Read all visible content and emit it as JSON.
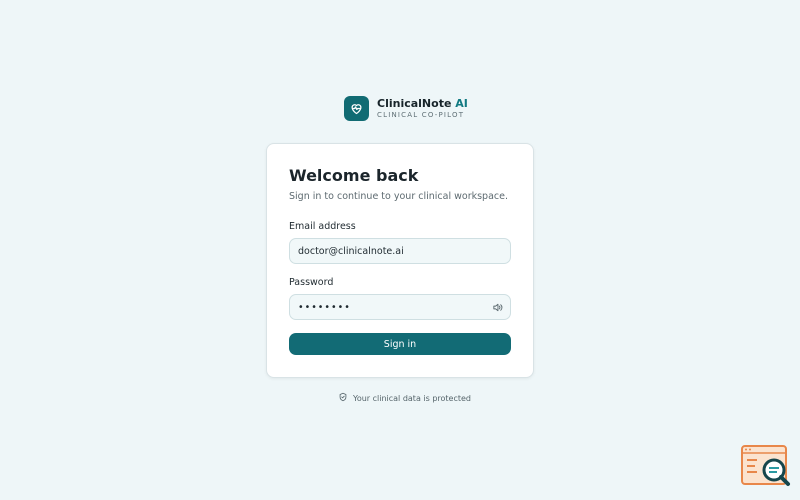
{
  "brand": {
    "name_main": "ClinicalNote",
    "name_accent": " AI",
    "tagline": "CLINICAL CO-PILOT",
    "logo_icon": "heart-pulse-icon"
  },
  "card": {
    "title": "Welcome back",
    "subtitle": "Sign in to continue to your clinical workspace.",
    "email_label": "Email address",
    "email_value": "doctor@clinicalnote.ai",
    "password_label": "Password",
    "password_value": "password",
    "password_toggle_icon": "speaker-icon",
    "signin_label": "Sign in"
  },
  "footer": {
    "note": "Your clinical data is protected",
    "icon": "shield-check-icon"
  },
  "colors": {
    "background": "#eef6f8",
    "primary": "#126b75",
    "accent": "#117a82"
  }
}
